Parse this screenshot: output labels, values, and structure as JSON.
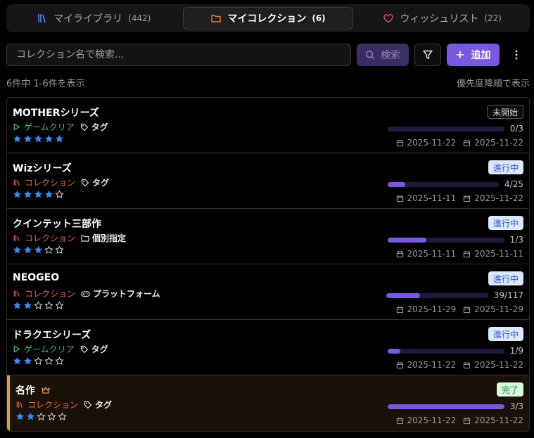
{
  "tabs": [
    {
      "label": "マイライブラリ",
      "count": "(442)",
      "icon": "library-icon",
      "active": false
    },
    {
      "label": "マイコレクション",
      "count": "(6)",
      "icon": "folder-icon",
      "active": true
    },
    {
      "label": "ウィッシュリスト",
      "count": "(22)",
      "icon": "heart-icon",
      "active": false
    }
  ],
  "search": {
    "placeholder": "コレクション名で検索...",
    "button_label": "検索"
  },
  "toolbar": {
    "add_label": "追加"
  },
  "summary": {
    "left": "6件中 1-6件を表示",
    "right": "優先度降順で表示"
  },
  "colors": {
    "accent": "#7a58e0",
    "game": "#39c46a",
    "collection": "#e0643a",
    "star": "#3a8af0",
    "crown": "#e0a020"
  },
  "items": [
    {
      "title": "MOTHERシリーズ",
      "type": "ゲームクリア",
      "type_kind": "game",
      "tag": "タグ",
      "tag_icon": "tag-icon",
      "stars": 5,
      "status": "未開始",
      "status_kind": "notstarted",
      "progress": "0/3",
      "ratio": 0,
      "date_created": "2025-11-22",
      "date_updated": "2025-11-22",
      "crown": false
    },
    {
      "title": "Wizシリーズ",
      "type": "コレクション",
      "type_kind": "coll",
      "tag": "タグ",
      "tag_icon": "tag-icon",
      "stars": 4,
      "status": "進行中",
      "status_kind": "inprogress",
      "progress": "4/25",
      "ratio": 0.16,
      "date_created": "2025-11-11",
      "date_updated": "2025-11-22",
      "crown": false
    },
    {
      "title": "クインテット三部作",
      "type": "コレクション",
      "type_kind": "coll",
      "tag": "個別指定",
      "tag_icon": "folder-icon",
      "stars": 3,
      "status": "進行中",
      "status_kind": "inprogress",
      "progress": "1/3",
      "ratio": 0.333,
      "date_created": "2025-11-11",
      "date_updated": "2025-11-11",
      "crown": false
    },
    {
      "title": "NEOGEO",
      "type": "コレクション",
      "type_kind": "coll",
      "tag": "プラットフォーム",
      "tag_icon": "gamepad-icon",
      "stars": 2,
      "status": "進行中",
      "status_kind": "inprogress",
      "progress": "39/117",
      "ratio": 0.333,
      "date_created": "2025-11-29",
      "date_updated": "2025-11-29",
      "crown": false
    },
    {
      "title": "ドラクエシリーズ",
      "type": "ゲームクリア",
      "type_kind": "game",
      "tag": "タグ",
      "tag_icon": "tag-icon",
      "stars": 2,
      "status": "進行中",
      "status_kind": "inprogress",
      "progress": "1/9",
      "ratio": 0.111,
      "date_created": "2025-11-22",
      "date_updated": "2025-11-22",
      "crown": false
    },
    {
      "title": "名作",
      "type": "コレクション",
      "type_kind": "coll",
      "tag": "タグ",
      "tag_icon": "tag-icon",
      "stars": 2,
      "status": "完了",
      "status_kind": "done",
      "progress": "3/3",
      "ratio": 1,
      "date_created": "2025-11-22",
      "date_updated": "2025-11-22",
      "crown": true
    }
  ]
}
